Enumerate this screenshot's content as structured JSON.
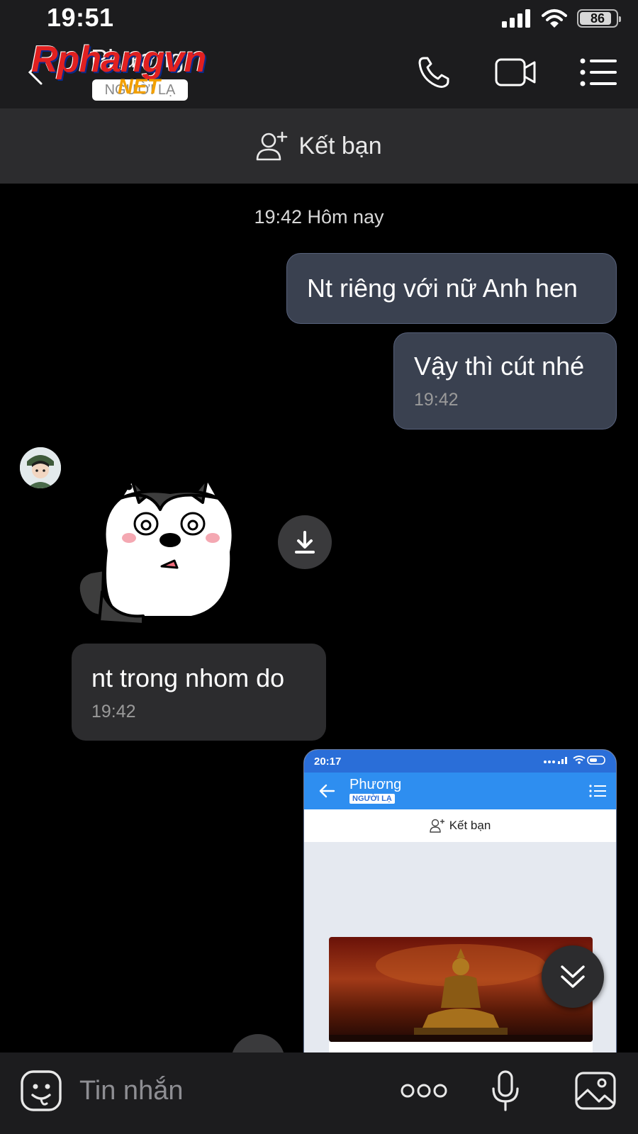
{
  "status_bar": {
    "time": "19:51",
    "battery": "86"
  },
  "header": {
    "contact_name": "Phương",
    "contact_badge": "NGƯỜI LẠ",
    "watermark_title": "Rphangvn",
    "watermark_net": "NET",
    "icons": [
      "back-arrow-icon",
      "phone-icon",
      "video-call-icon",
      "menu-list-icon"
    ]
  },
  "friend_bar": {
    "label": "Kết bạn"
  },
  "chat": {
    "date_separator": "19:42 Hôm nay",
    "messages": [
      {
        "direction": "out",
        "text": "Nt riêng với nữ Anh hen",
        "time": ""
      },
      {
        "direction": "out",
        "text": "Vậy thì cút nhé",
        "time": "19:42"
      },
      {
        "direction": "in",
        "type": "sticker",
        "description": "husky-confused-sticker"
      },
      {
        "direction": "in",
        "text": "nt trong nhom do",
        "time": "19:42"
      },
      {
        "direction": "out",
        "type": "image"
      }
    ]
  },
  "screenshot_preview": {
    "time": "20:17",
    "contact_name": "Phương",
    "badge": "NGƯỜI LẠ",
    "friend_label": "Kết bạn"
  },
  "input_bar": {
    "placeholder": "Tin nhắn"
  },
  "colors": {
    "background": "#000000",
    "header": "#1c1c1e",
    "outgoing_bubble": "#3a4150",
    "incoming_bubble": "#2c2c2e",
    "accent_blue": "#2e8ef0"
  }
}
